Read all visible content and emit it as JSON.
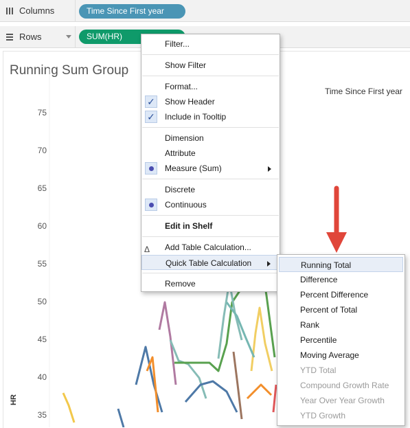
{
  "columns_shelf": {
    "label": "Columns",
    "pill": "Time Since First year"
  },
  "rows_shelf": {
    "label": "Rows",
    "pill": "SUM(HR)"
  },
  "sheet": {
    "title": "Running Sum Group",
    "column_header": "Time Since First year",
    "y_axis_label": "HR",
    "y_ticks": [
      "75",
      "70",
      "65",
      "60",
      "55",
      "50",
      "45",
      "40",
      "35"
    ]
  },
  "context_menu": {
    "filter": "Filter...",
    "show_filter": "Show Filter",
    "format": "Format...",
    "show_header": "Show Header",
    "include_tooltip": "Include in Tooltip",
    "dimension": "Dimension",
    "attribute": "Attribute",
    "measure": "Measure (Sum)",
    "discrete": "Discrete",
    "continuous": "Continuous",
    "edit_in_shelf": "Edit in Shelf",
    "add_table_calc": "Add Table Calculation...",
    "quick_table_calc": "Quick Table Calculation",
    "remove": "Remove",
    "check_glyph": "✓",
    "delta_glyph": "Δ"
  },
  "submenu": {
    "running_total": "Running Total",
    "difference": "Difference",
    "percent_difference": "Percent Difference",
    "percent_of_total": "Percent of Total",
    "rank": "Rank",
    "percentile": "Percentile",
    "moving_average": "Moving Average",
    "ytd_total": "YTD Total",
    "compound_growth_rate": "Compound Growth Rate",
    "year_over_year_growth": "Year Over Year Growth",
    "ytd_growth": "YTD Growth"
  },
  "colors": {
    "pill_blue": "#4a95b5",
    "pill_green": "#0f9a6a",
    "highlight": "#e8eef7",
    "annotation_red": "#e0463a"
  }
}
